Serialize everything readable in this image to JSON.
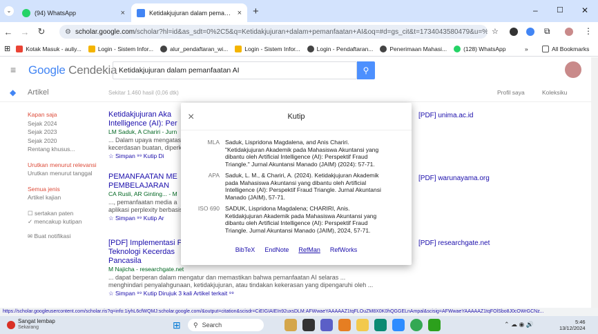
{
  "tabs": [
    {
      "title": "(94) WhatsApp",
      "close": "×"
    },
    {
      "title": "Ketidakjujuran dalam pemanfaa",
      "close": "×"
    }
  ],
  "new_tab": "+",
  "window_controls": {
    "min": "–",
    "max": "☐",
    "close": "✕"
  },
  "url": {
    "domain": "scholar.google.com",
    "path": "/scholar?hl=id&as_sdt=0%2C5&q=Ketidakjujuran+dalam+pemanfaatan+AI&oq=#d=gs_cit&t=1734043580479&u=%2Fscholar%3Fq..."
  },
  "bookmarks": [
    "Kotak Masuk - auliy...",
    "Login - Sistem Infor...",
    "alur_pendaftaran_wi...",
    "Login - Sistem Infor...",
    "Login - Pendaftaran...",
    "Login - Pendaftaran...",
    "Penerimaan Mahasi...",
    "(128) WhatsApp"
  ],
  "all_bookmarks": "All Bookmarks",
  "more_bookmarks": "»",
  "logo": {
    "brand": "Google",
    "product": " Cendekia"
  },
  "search": {
    "value": "Ketidakjujuran dalam pemanfaatan AI",
    "icon": "search-icon"
  },
  "subbar": {
    "section": "Artikel",
    "results": "Sekitar 1.460 hasil (0,06 dtk)",
    "profile": "Profil saya",
    "library": "Koleksiku"
  },
  "sidebar": {
    "time": [
      "Kapan saja",
      "Sejak 2024",
      "Sejak 2023",
      "Sejak 2020",
      "Rentang khusus..."
    ],
    "sort": [
      "Urutkan menurut relevansi",
      "Urutkan menurut tanggal"
    ],
    "type": [
      "Semua jenis",
      "Artikel kajian"
    ],
    "patents": "sertakan paten",
    "citations": "mencakup kutipan",
    "alert": "Buat notifikasi"
  },
  "results": [
    {
      "title1": "Ketidakjujuran Aka",
      "title2": "Intelligence (AI): Per",
      "authors": "LM Saduk, A Chariri - Jurn",
      "snippet1": "... Dalam upaya mengatas",
      "snippet2": "kecerdasan buatan, diperk",
      "actions": "☆ Simpan  ⁹⁹ Kutip  Di",
      "pdf": "[PDF] unima.ac.id"
    },
    {
      "title1": "PEMANFAATAN ME",
      "title2": "PEMBELAJARAN",
      "authors": "CA Rusli, AR Ginting... - M",
      "snippet1": "..., pemanfaatan media a",
      "snippet2": "aplikasi perplexity berbasis",
      "actions": "☆ Simpan  ⁹⁹ Kutip  Ar",
      "pdf": "[PDF] warunayama.org"
    },
    {
      "title1": "[PDF] Implementasi P",
      "title2": "Teknologi Kecerdas",
      "title3": "Pancasila",
      "authors": "M Najicha - researchgate.net",
      "snippet1": "... dapat berperan dalam mengatur dan memastikan bahwa pemanfaatan AI selaras ...",
      "snippet2": "menghindari penyalahgunaan, ketidakjujuran, atau tindakan kekerasan yang dipengaruhi oleh ...",
      "actions": "☆ Simpan  ⁹⁹ Kutip  Dirujuk 3 kali  Artikel terkait  ⁹⁹",
      "pdf": "[PDF] researchgate.net"
    }
  ],
  "modal": {
    "title": "Kutip",
    "close": "×",
    "citations": [
      {
        "style": "MLA",
        "text": "Saduk, Lispridona Magdalena, and Anis Chariri. \"Ketidakjujuran Akademik pada Mahasiswa Akuntansi yang dibantu oleh Artificial Intelligence (AI): Perspektif Fraud Triangle.\" Jurnal Akuntansi Manado (JAIM) (2024): 57-71."
      },
      {
        "style": "APA",
        "text": "Saduk, L. M., & Chariri, A. (2024). Ketidakjujuran Akademik pada Mahasiswa Akuntansi yang dibantu oleh Artificial Intelligence (AI): Perspektif Fraud Triangle. Jurnal Akuntansi Manado (JAIM), 57-71."
      },
      {
        "style": "ISO 690",
        "text": "SADUK, Lispridona Magdalena; CHARIRI, Anis. Ketidakjujuran Akademik pada Mahasiswa Akuntansi yang dibantu oleh Artificial Intelligence (AI): Perspektif Fraud Triangle. Jurnal Akuntansi Manado (JAIM), 2024, 57-71."
      }
    ],
    "links": [
      "BibTeX",
      "EndNote",
      "RefMan",
      "RefWorks"
    ]
  },
  "status_url": "https://scholar.googleusercontent.com/scholar.ris?q=info:1iyhL6cfWQMJ:scholar.google.com/&output=citation&scisdr=CiEIGIAIEIn92uxsDLM:AFWwaeYAAAAAZ1tqFLOuZM8X0K0hQGGELnAmpal&scisig=AFWwaeYAAAAAZ1tqFOlSbo8J0cOWrGCNz...",
  "taskbar": {
    "weather_title": "Sangat lembap",
    "weather_sub": "Sekarang",
    "search": "Search",
    "time": "5:46",
    "date": "13/12/2024"
  }
}
